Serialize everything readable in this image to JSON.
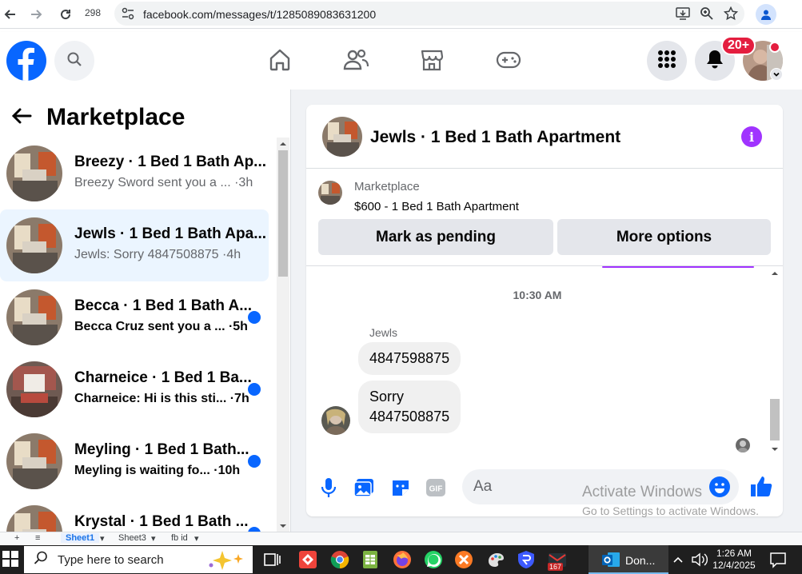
{
  "browser": {
    "tab_count": "298",
    "url": "facebook.com/messages/t/1285089083631200"
  },
  "fb": {
    "notification_badge": "20+",
    "brand_color": "#0866ff"
  },
  "left": {
    "title": "Marketplace",
    "conversations": [
      {
        "name": "Breezy · 1 Bed 1 Bath Ap...",
        "preview": "Breezy Sword sent you a ... ·3h",
        "unread": false,
        "active": false
      },
      {
        "name": "Jewls · 1 Bed 1 Bath Apa...",
        "preview": "Jewls: Sorry 4847508875 ·4h",
        "unread": false,
        "active": true
      },
      {
        "name": "Becca · 1 Bed 1 Bath A...",
        "preview": "Becca Cruz sent you a ... ·5h",
        "unread": true,
        "active": false
      },
      {
        "name": "Charneice · 1 Bed 1 Ba...",
        "preview": "Charneice: Hi is this sti... ·7h",
        "unread": true,
        "active": false
      },
      {
        "name": "Meyling · 1 Bed 1 Bath...",
        "preview": "Meyling is waiting fo... ·10h",
        "unread": true,
        "active": false
      },
      {
        "name": "Krystal · 1 Bed 1 Bath ...",
        "preview": "",
        "unread": true,
        "active": false
      }
    ]
  },
  "chat": {
    "title": "Jewls · 1 Bed 1 Bath Apartment",
    "marketplace_label": "Marketplace",
    "listing": "$600 - 1 Bed 1 Bath Apartment",
    "mark_pending": "Mark as pending",
    "more_options": "More options",
    "timestamp": "10:30 AM",
    "sender": "Jewls",
    "messages": [
      {
        "lines": [
          "4847598875"
        ]
      },
      {
        "lines": [
          "Sorry",
          "4847508875"
        ]
      }
    ],
    "input_placeholder": "Aa"
  },
  "watermark": {
    "line1": "Activate Windows",
    "line2": "Go to Settings to activate Windows."
  },
  "sheets": {
    "tabs": [
      "Sheet1",
      "Sheet3",
      "fb id"
    ]
  },
  "taskbar": {
    "search_placeholder": "Type here to search",
    "app_label": "Don...",
    "app_badge": "167",
    "time": "1:26 AM",
    "date": "12/4/2025"
  }
}
